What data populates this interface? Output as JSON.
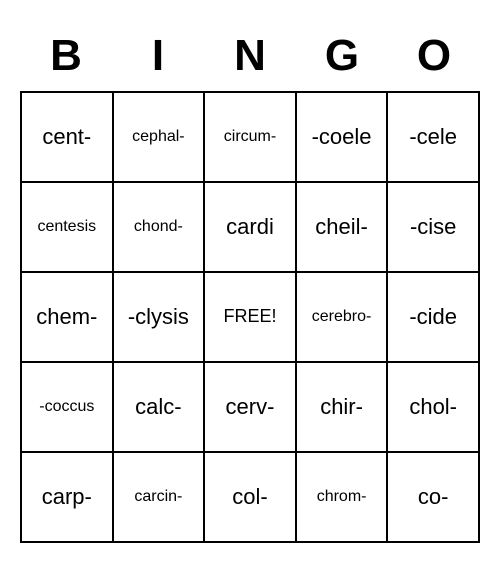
{
  "header": [
    "B",
    "I",
    "N",
    "G",
    "O"
  ],
  "grid": [
    [
      {
        "text": "cent-"
      },
      {
        "text": "cephal-",
        "size": "small"
      },
      {
        "text": "circum-",
        "size": "small"
      },
      {
        "text": "-coele"
      },
      {
        "text": "-cele"
      }
    ],
    [
      {
        "text": "centesis",
        "size": "small"
      },
      {
        "text": "chond-",
        "size": "small"
      },
      {
        "text": "cardi"
      },
      {
        "text": "cheil-"
      },
      {
        "text": "-cise"
      }
    ],
    [
      {
        "text": "chem-"
      },
      {
        "text": "-clysis"
      },
      {
        "text": "FREE!",
        "size": "free"
      },
      {
        "text": "cerebro-",
        "size": "small"
      },
      {
        "text": "-cide"
      }
    ],
    [
      {
        "text": "-coccus",
        "size": "small"
      },
      {
        "text": "calc-"
      },
      {
        "text": "cerv-"
      },
      {
        "text": "chir-"
      },
      {
        "text": "chol-"
      }
    ],
    [
      {
        "text": "carp-"
      },
      {
        "text": "carcin-",
        "size": "small"
      },
      {
        "text": "col-"
      },
      {
        "text": "chrom-",
        "size": "small"
      },
      {
        "text": "co-"
      }
    ]
  ]
}
